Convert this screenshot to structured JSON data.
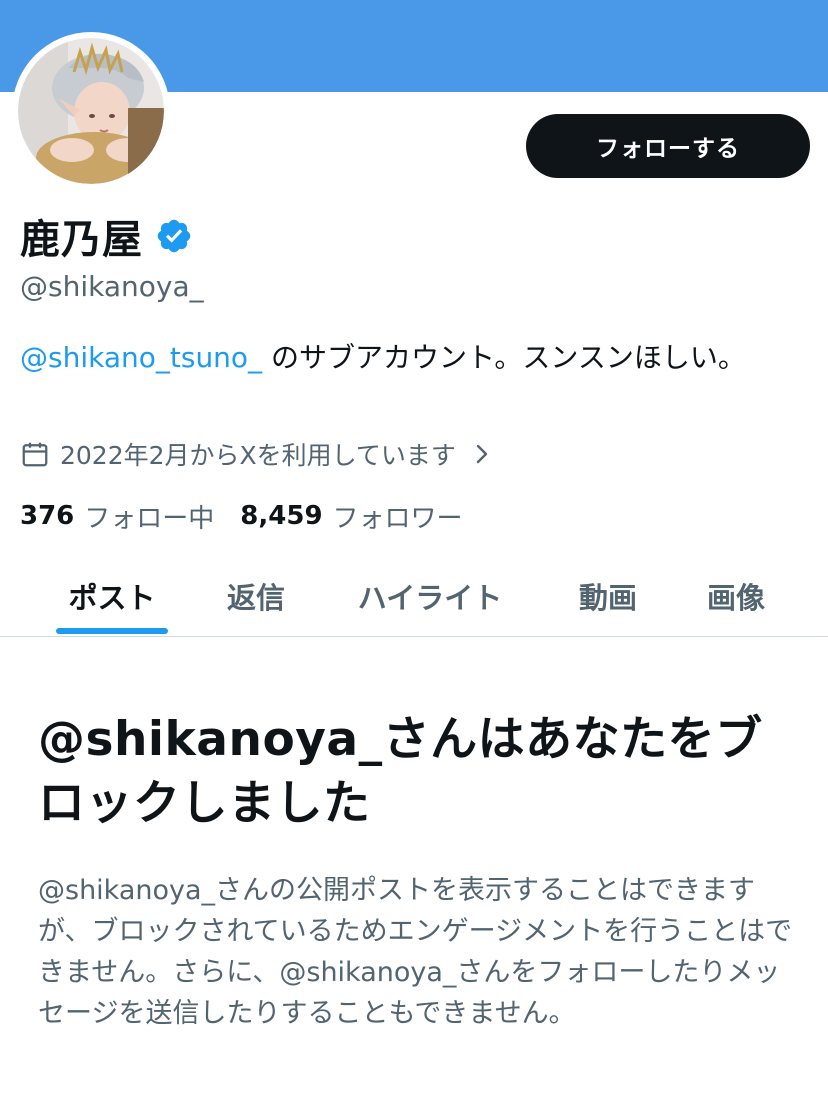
{
  "profile": {
    "display_name": "鹿乃屋",
    "handle": "@shikanoya_",
    "bio_mention": "@shikano_tsuno_",
    "bio_text": " のサブアカウント。スンスンほしい。",
    "joined": "2022年2月からXを利用しています",
    "following_count": "376",
    "following_label": "フォロー中",
    "followers_count": "8,459",
    "followers_label": "フォロワー"
  },
  "actions": {
    "follow_label": "フォローする"
  },
  "tabs": [
    {
      "label": "ポスト",
      "active": true
    },
    {
      "label": "返信",
      "active": false
    },
    {
      "label": "ハイライト",
      "active": false
    },
    {
      "label": "動画",
      "active": false
    },
    {
      "label": "画像",
      "active": false
    }
  ],
  "blocked_notice": {
    "title": "@shikanoya_さんはあなたをブロックしました",
    "description": "@shikanoya_さんの公開ポストを表示することはできますが、ブロックされているためエンゲージメントを行うことはできません。さらに、@shikanoya_さんをフォローしたりメッセージを送信したりすることもできません。"
  },
  "colors": {
    "banner": "#4a99e9",
    "accent": "#1d9bf0",
    "text_primary": "#0f1419",
    "text_secondary": "#536471",
    "button_bg": "#0f1419"
  },
  "icons": [
    "verified-badge-icon",
    "calendar-icon",
    "chevron-right-icon"
  ]
}
